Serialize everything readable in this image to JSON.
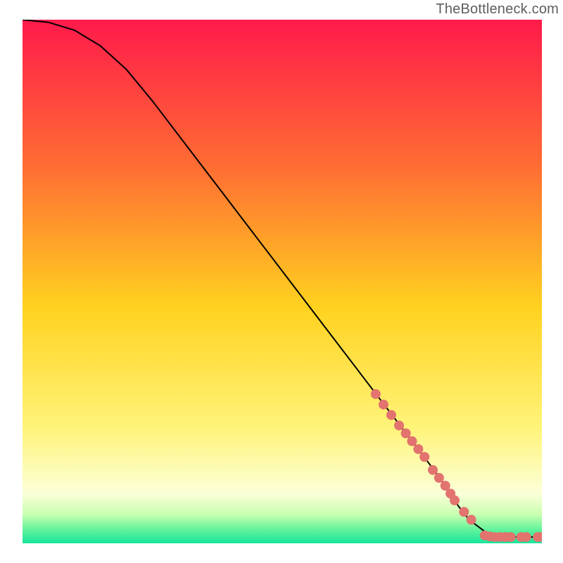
{
  "watermark": {
    "text": "TheBottleneck.com"
  },
  "chart_data": {
    "type": "line",
    "title": "",
    "xlabel": "",
    "ylabel": "",
    "xlim": [
      0,
      100
    ],
    "ylim": [
      0,
      100
    ],
    "grid": false,
    "legend": false,
    "background_gradient_stops": [
      {
        "pos": 0.0,
        "color": "#ff1a4b"
      },
      {
        "pos": 0.28,
        "color": "#ff6d33"
      },
      {
        "pos": 0.55,
        "color": "#ffd21f"
      },
      {
        "pos": 0.78,
        "color": "#fff47a"
      },
      {
        "pos": 0.905,
        "color": "#fbffd8"
      },
      {
        "pos": 0.945,
        "color": "#c9ffb0"
      },
      {
        "pos": 0.975,
        "color": "#5ff29b"
      },
      {
        "pos": 1.0,
        "color": "#17e49b"
      }
    ],
    "curve": {
      "x": [
        0,
        5,
        10,
        15,
        20,
        25,
        30,
        40,
        50,
        60,
        70,
        80,
        82,
        84,
        86,
        90,
        95,
        100
      ],
      "y": [
        100,
        99.5,
        98,
        95,
        90.5,
        84.5,
        78,
        65,
        52,
        39,
        26,
        13,
        10,
        7,
        4.5,
        1.5,
        1.2,
        1.2
      ]
    },
    "markers": {
      "shape": "circle",
      "color": "#e2736e",
      "radius_px": 7,
      "points": [
        {
          "x": 68,
          "y": 28.5
        },
        {
          "x": 69.5,
          "y": 26.5
        },
        {
          "x": 71,
          "y": 24.5
        },
        {
          "x": 72.5,
          "y": 22.5
        },
        {
          "x": 73.8,
          "y": 21.0
        },
        {
          "x": 75,
          "y": 19.5
        },
        {
          "x": 76.2,
          "y": 18.0
        },
        {
          "x": 77.4,
          "y": 16.5
        },
        {
          "x": 79,
          "y": 14.0
        },
        {
          "x": 80.2,
          "y": 12.5
        },
        {
          "x": 81.4,
          "y": 11.0
        },
        {
          "x": 82.4,
          "y": 9.5
        },
        {
          "x": 83.2,
          "y": 8.2
        },
        {
          "x": 85,
          "y": 6.0
        },
        {
          "x": 86.4,
          "y": 4.5
        },
        {
          "x": 89,
          "y": 1.5
        },
        {
          "x": 90,
          "y": 1.3
        },
        {
          "x": 91,
          "y": 1.2
        },
        {
          "x": 92,
          "y": 1.2
        },
        {
          "x": 93,
          "y": 1.2
        },
        {
          "x": 94,
          "y": 1.2
        },
        {
          "x": 96,
          "y": 1.2
        },
        {
          "x": 97,
          "y": 1.2
        },
        {
          "x": 99.2,
          "y": 1.2
        },
        {
          "x": 100,
          "y": 1.2
        }
      ]
    }
  }
}
